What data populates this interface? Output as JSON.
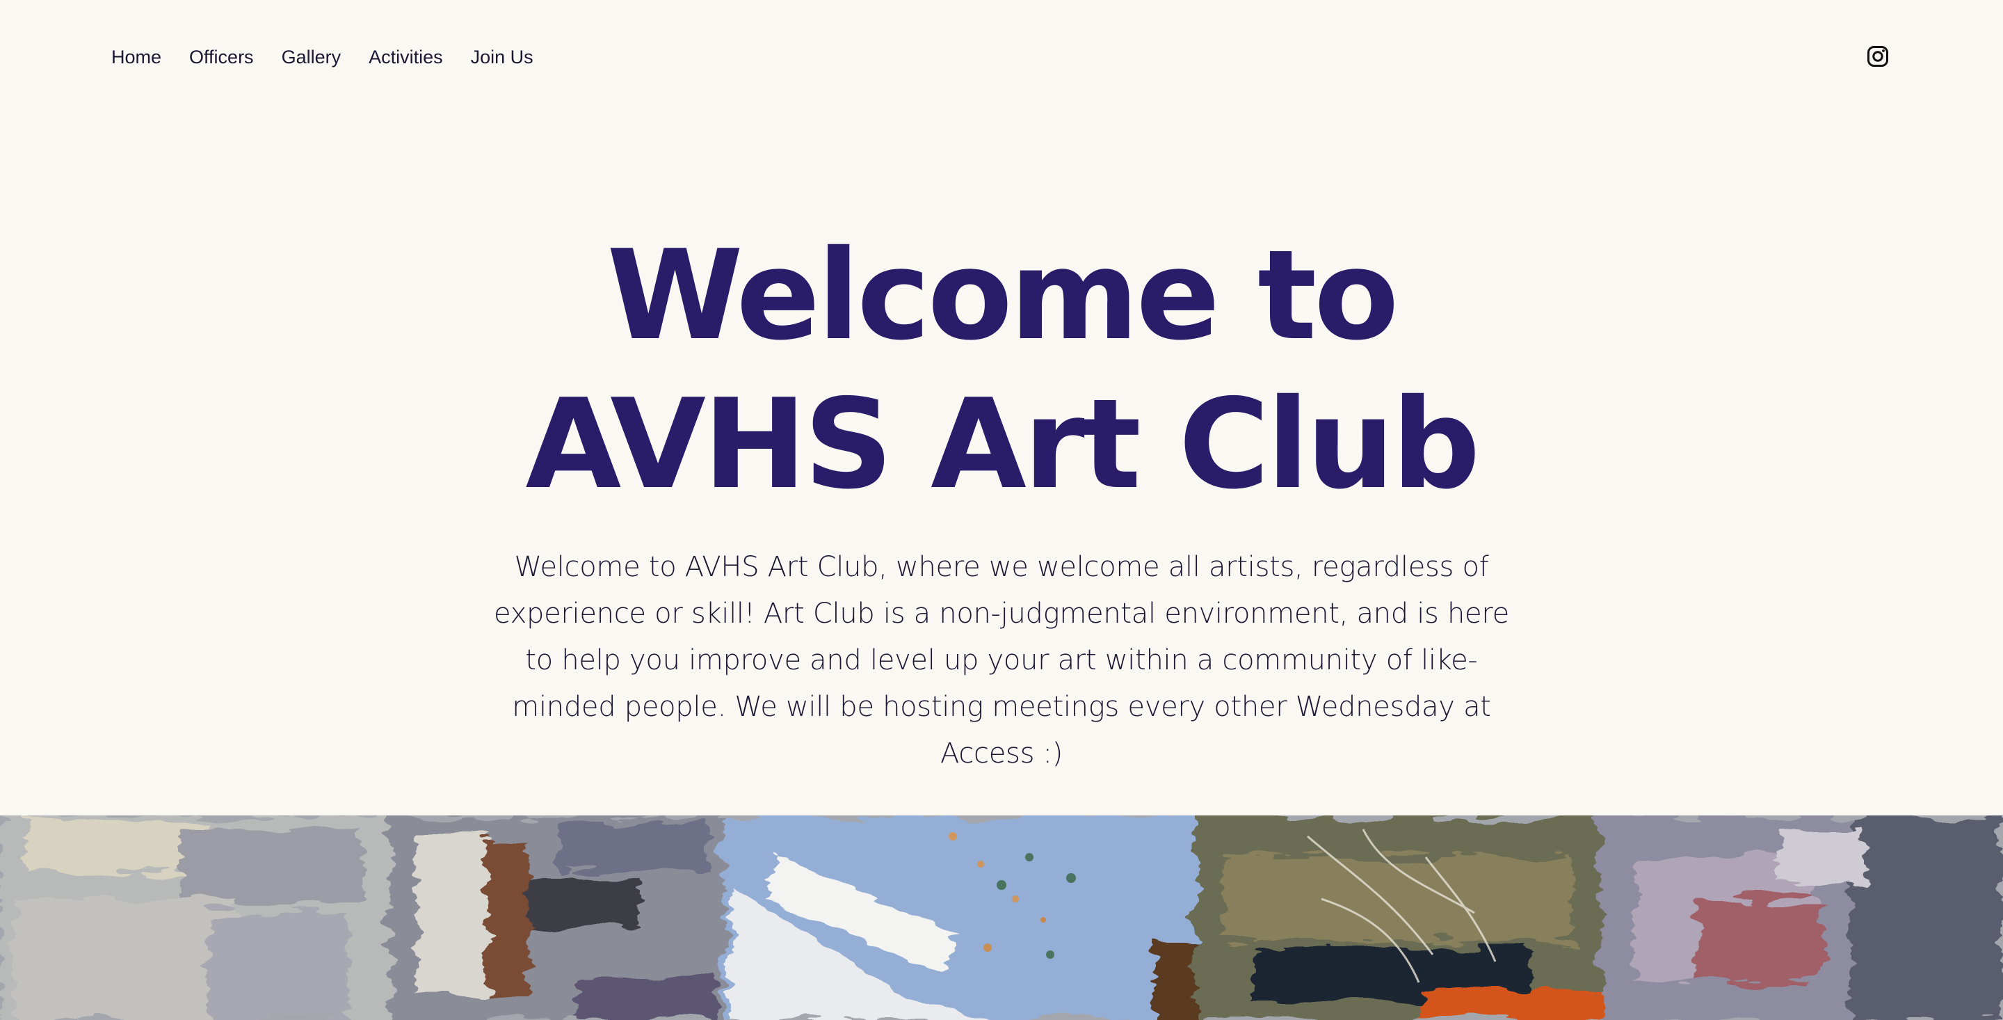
{
  "nav": {
    "items": [
      "Home",
      "Officers",
      "Gallery",
      "Activities",
      "Join Us"
    ]
  },
  "social": {
    "icon": "instagram-icon"
  },
  "hero": {
    "title_line1": "Welcome to",
    "title_line2": "AVHS Art Club",
    "description": "Welcome to AVHS Art Club, where we welcome all artists, regardless of experience or skill! Art Club is a non-judgmental environment, and is here to help you improve and level up your art within a community of like-minded people. We will be hosting meetings every other Wednesday at Access :)"
  },
  "colors": {
    "background": "#f9f8f3",
    "title": "#291d6a",
    "text": "#1b1833"
  }
}
